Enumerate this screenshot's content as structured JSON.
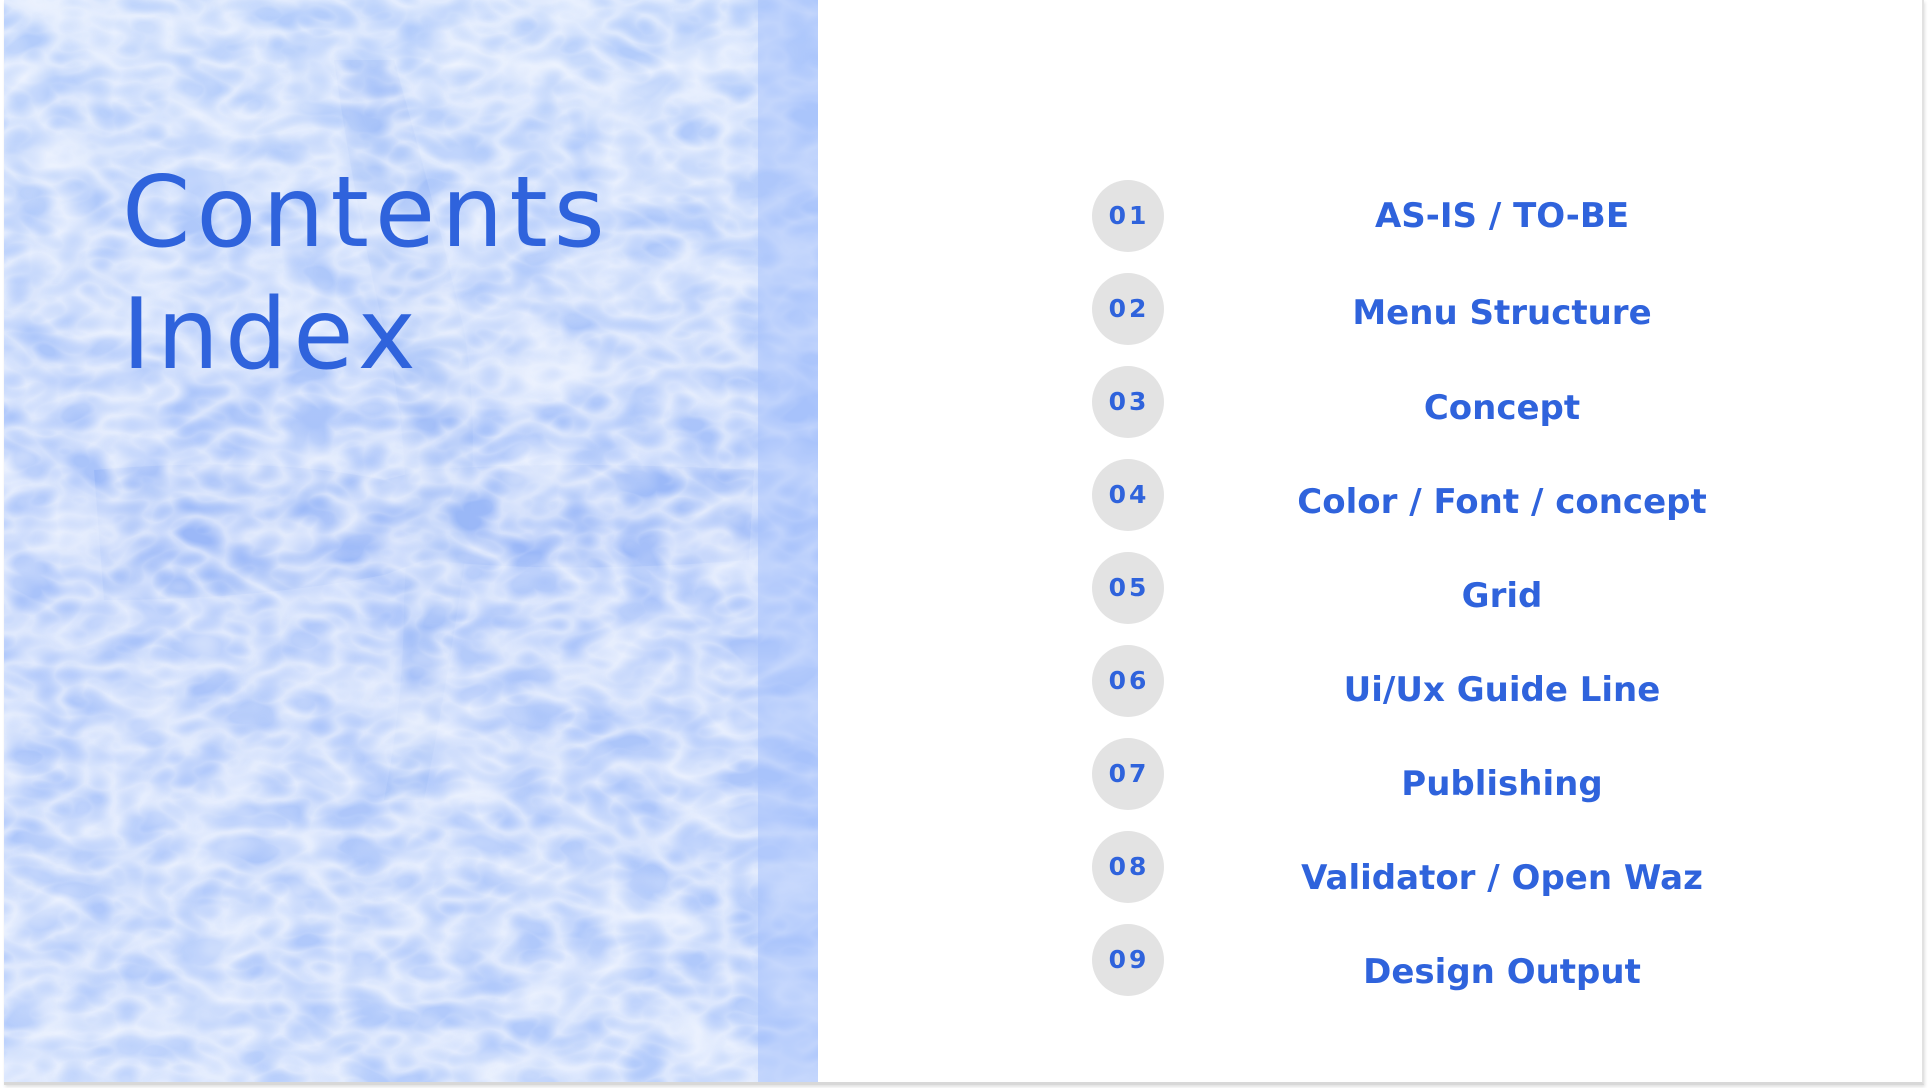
{
  "title": {
    "line1": "Contents",
    "line2": "Index"
  },
  "colors": {
    "accent": "#2f63dc",
    "badge": "#e3e3e3",
    "water": "#a9c4fb"
  },
  "items": [
    {
      "number": "01",
      "label": "AS-IS / TO-BE"
    },
    {
      "number": "02",
      "label": "Menu Structure"
    },
    {
      "number": "03",
      "label": "Concept"
    },
    {
      "number": "04",
      "label": "Color / Font / concept"
    },
    {
      "number": "05",
      "label": "Grid"
    },
    {
      "number": "06",
      "label": "Ui/Ux Guide Line"
    },
    {
      "number": "07",
      "label": "Publishing"
    },
    {
      "number": "08",
      "label": "Validator / Open Waz"
    },
    {
      "number": "09",
      "label": "Design Output"
    }
  ]
}
